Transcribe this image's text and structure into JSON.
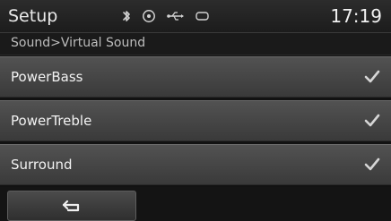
{
  "header": {
    "title": "Setup",
    "time": "17:19"
  },
  "status_icons": [
    "bluetooth-icon",
    "disc-icon",
    "usb-icon",
    "aux-icon"
  ],
  "breadcrumb": "Sound>Virtual Sound",
  "items": [
    {
      "label": "PowerBass",
      "checked": true
    },
    {
      "label": "PowerTreble",
      "checked": true
    },
    {
      "label": "Surround",
      "checked": true
    }
  ],
  "buttons": {
    "back_icon": "back-arrow-icon"
  }
}
